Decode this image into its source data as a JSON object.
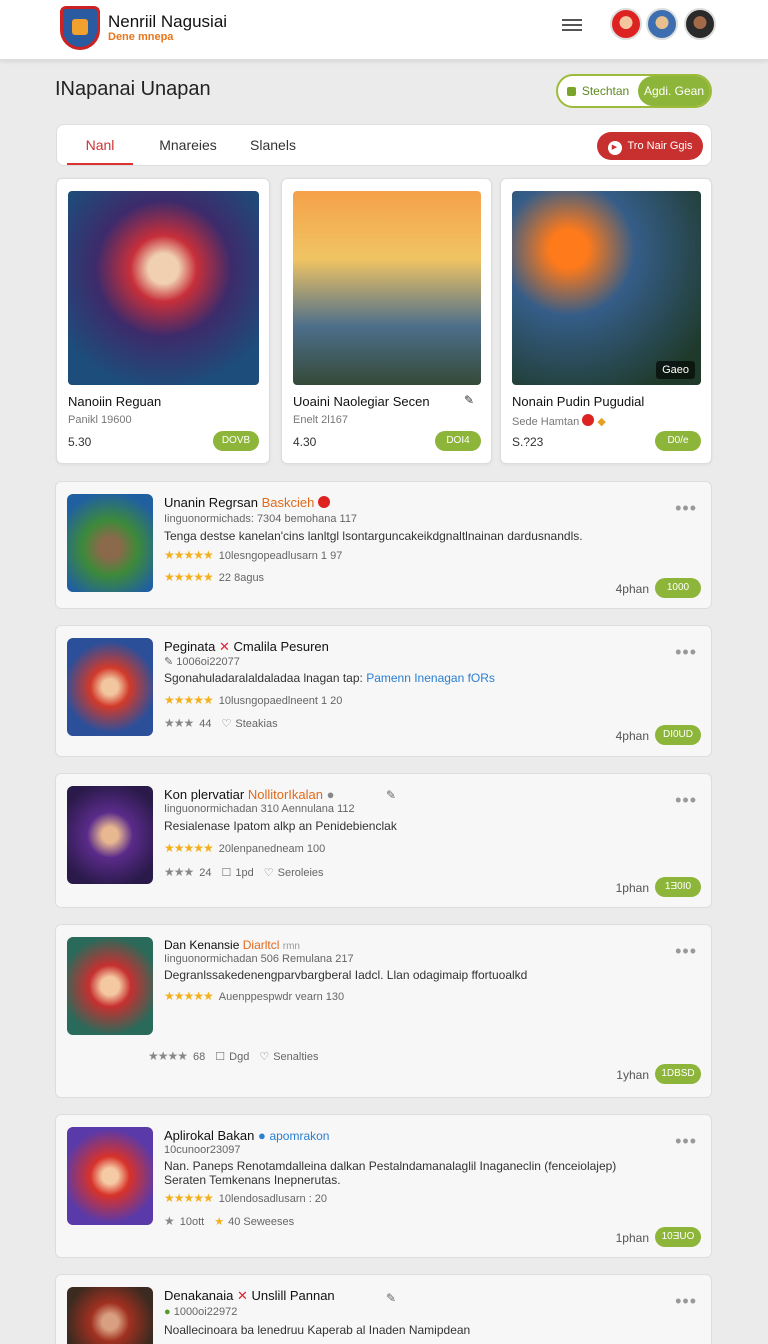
{
  "header": {
    "brand_name": "Nenriil Nagusiai",
    "brand_sub": "Dene mnepa"
  },
  "page": {
    "title": "INapanai Unapan",
    "toggle": [
      "Stechtan",
      "Agdi. Gean"
    ]
  },
  "tabs": [
    "Nanl",
    "Mnareies",
    "Slanels"
  ],
  "tab_action": "Tro Nair Ggis",
  "featured": [
    {
      "title": "Nanoiin Reguan",
      "sub": "Panikl 19600",
      "price": "5.30",
      "button": "DOVB"
    },
    {
      "title": "Uoaini Naolegiar Secen",
      "sub": "Enelt 2l167",
      "price": "4.30",
      "button": "DOI4"
    },
    {
      "title": "Nonain Pudin Pugudial",
      "sub": "Sede Hamtan",
      "price": "S.?23",
      "button": "D0/e",
      "image_label": "Gaeo"
    }
  ],
  "items": [
    {
      "title": "Unanin Regrsan",
      "title_hl": "Baskcieh",
      "line1": "Iinguonormichads:   7304 bemohana 117",
      "desc": "Tenga destse kanelan'cins lanltgl lsontarguncakeikdgnaltlnainan dardusnandls.",
      "rating_text": "10lesngopeadlusarn 1 97",
      "reviews": "22 8agus",
      "meta": "4phan",
      "button": "1000"
    },
    {
      "title": "Peginata",
      "title_hl": "Cmalila Pesuren",
      "line1": "1006oi22077",
      "desc": "Sgonahuladaralaldaladaa lnagan tap:",
      "desc_link": "Pamenn Inenagan fORs",
      "rating_text": "10lusngopaedlneent 1 20",
      "rating_count": "44",
      "extra": "Steakias",
      "meta": "4phan",
      "button": "DI0UD"
    },
    {
      "title": "Kon plervatiar",
      "title_hl": "NollitorIkalan",
      "line1": "Iinguonormichadan   310 Aennulana 112",
      "desc": "Resialenase Ipatom alkp an Penidebienclak",
      "rating_text": "20lenpanedneam 100",
      "rating_count": "24",
      "extra_a": "1pd",
      "extra_b": "Seroleies",
      "meta": "1phan",
      "button": "1Ǝ0I0"
    },
    {
      "title": "Dan Kenansie",
      "title_hl": "Diarltcl",
      "title_tail": "rmn",
      "line1": "Iinguonormichadan   506 Remulana 217",
      "desc": "Degranlssakedenengparvbargberal Iadcl. Llan odagimaip ffortuoalkd",
      "rating_text": "Auenppespwdr vearn 130",
      "rating_count": "68",
      "extra_a": "Dgd",
      "extra_b": "Senalties",
      "meta": "1yhan",
      "button": "1DBSD"
    },
    {
      "title": "Aplirokal Bakan",
      "title_blue": "apomrakon",
      "line1": "10cunoor23097",
      "desc": "Nan. Paneps Renotamdalleina dalkan Pestalndamanalaglil Inaganeclin (fenceiolajep)",
      "desc2": "Seraten Temkenans Inepnerutas.",
      "rating_text": "10lendosadlusarn : 20",
      "reviews": "10ott",
      "extra": "40 Seweeses",
      "meta": "1phan",
      "button": "10ƎUO"
    },
    {
      "title": "Denakanaia",
      "title_hl2": "Unslill Pannan",
      "line1": "1000oi22972",
      "desc": "Noallecinoara ba lenedruu Kaperab al Inaden Namipdean"
    }
  ]
}
